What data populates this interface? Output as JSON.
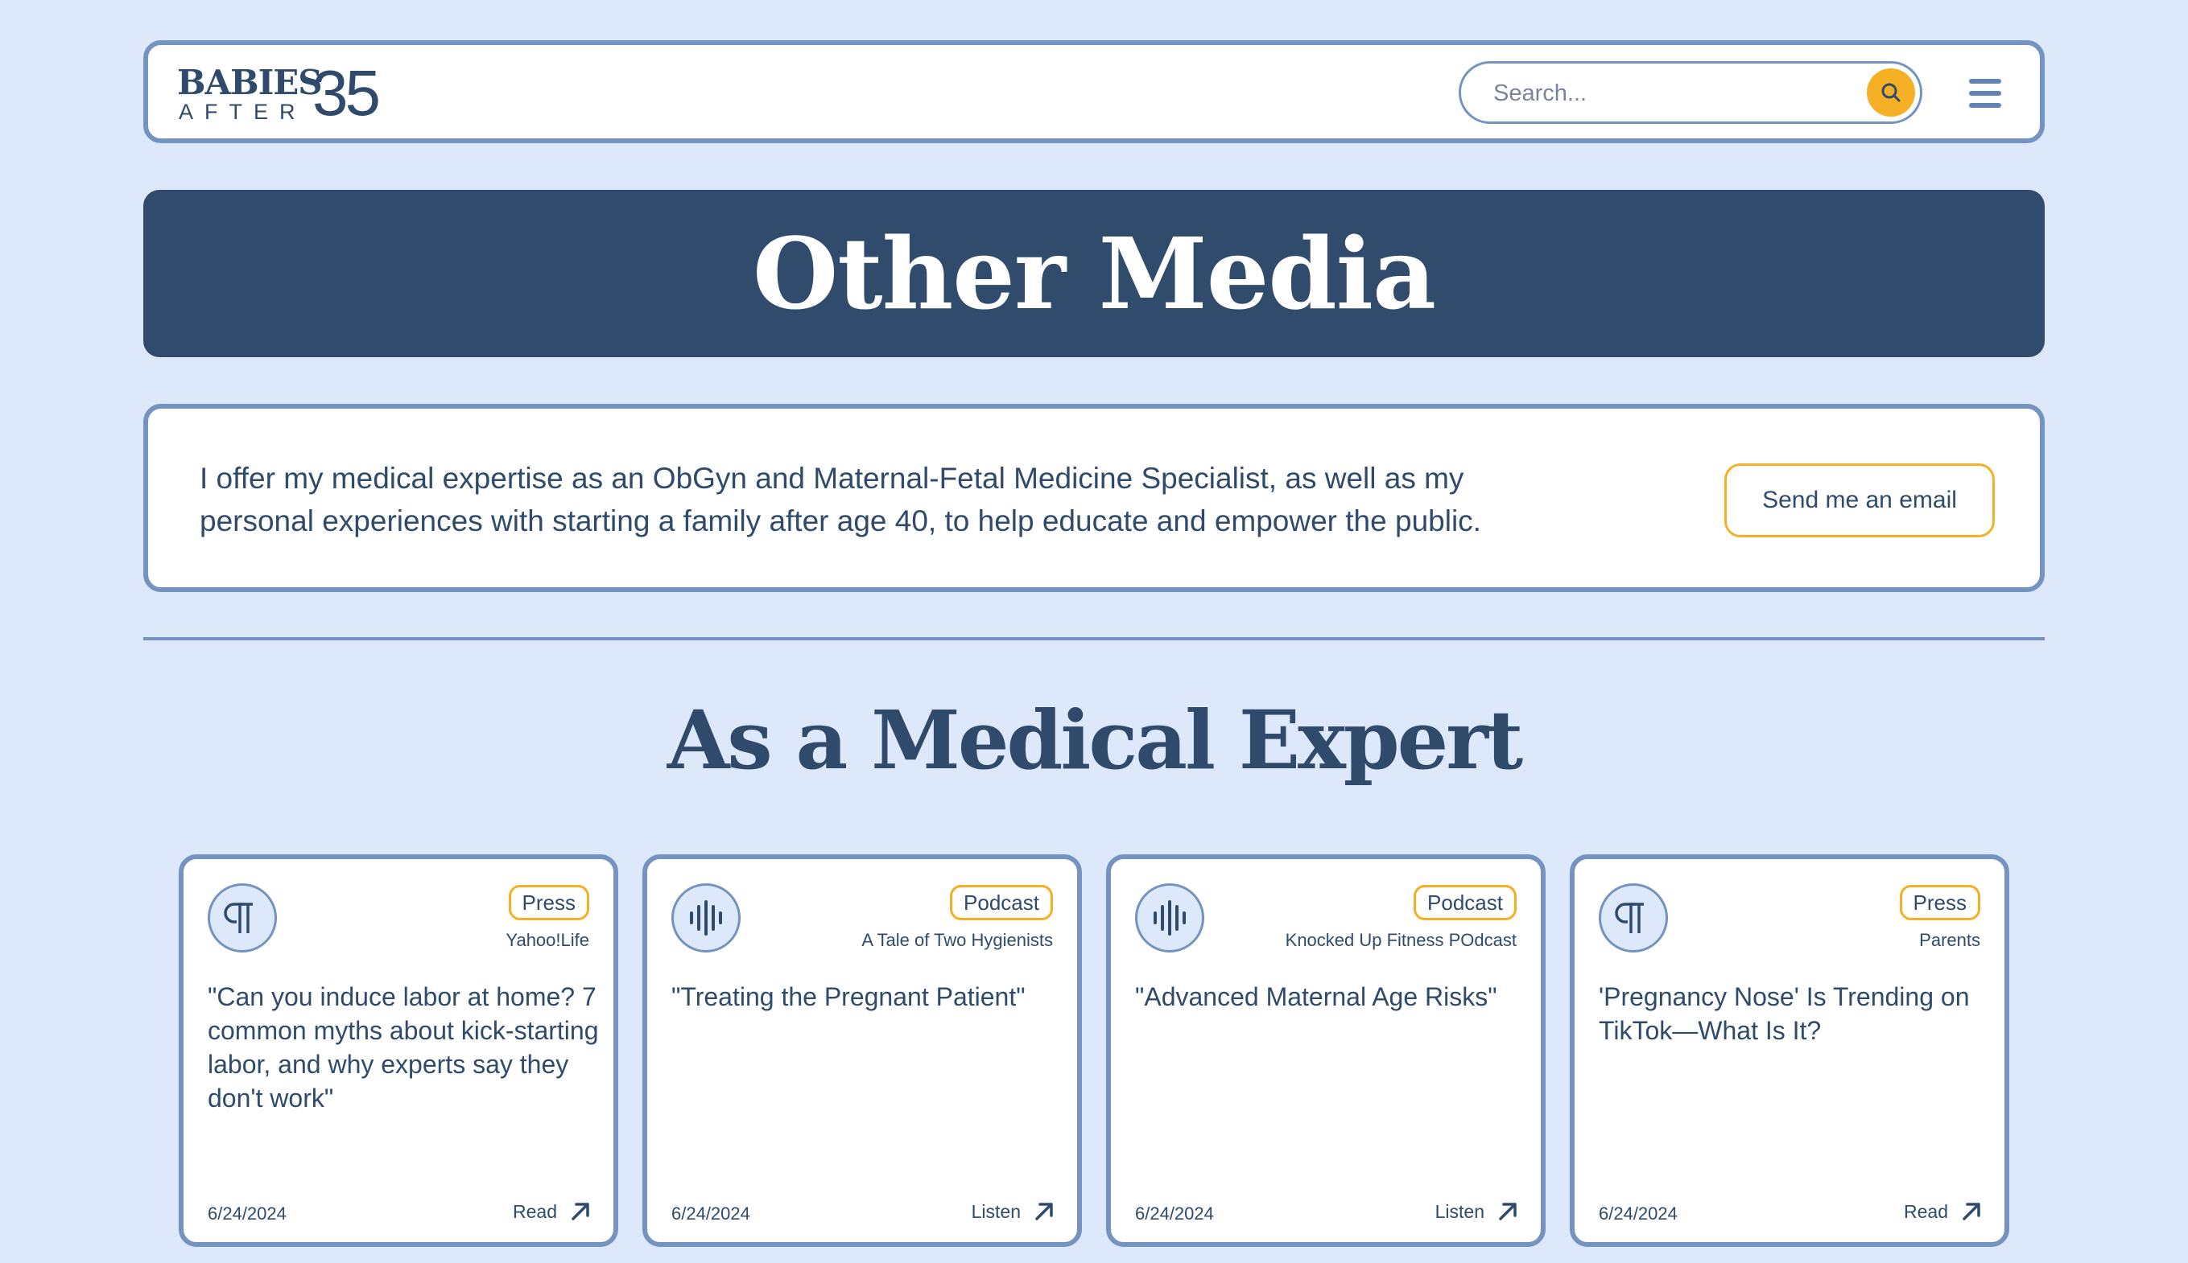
{
  "header": {
    "logo_top": "BABIES",
    "logo_bottom": "AFTER",
    "logo_number": "35",
    "search_placeholder": "Search...",
    "search_icon": "search-icon",
    "menu_icon": "hamburger-menu-icon"
  },
  "banner": {
    "title": "Other Media"
  },
  "intro": {
    "text": "I offer my medical expertise as an ObGyn and Maternal-Fetal Medicine Specialist, as well as my personal experiences with starting a family after age 40, to help educate and empower the public.",
    "button_label": "Send me an email"
  },
  "section": {
    "heading": "As a Medical Expert"
  },
  "cards": [
    {
      "icon": "paragraph-icon",
      "badge": "Press",
      "source": "Yahoo!Life",
      "title": "\"Can you induce labor at home? 7 common myths about kick-starting labor, and why experts say they don't work\"",
      "date": "6/24/2024",
      "action": "Read"
    },
    {
      "icon": "audio-waveform-icon",
      "badge": "Podcast",
      "source": "A Tale of Two Hygienists",
      "title": "\"Treating the Pregnant Patient\"",
      "date": "6/24/2024",
      "action": "Listen"
    },
    {
      "icon": "audio-waveform-icon",
      "badge": "Podcast",
      "source": "Knocked Up Fitness POdcast",
      "title": "\"Advanced Maternal Age Risks\"",
      "date": "6/24/2024",
      "action": "Listen"
    },
    {
      "icon": "paragraph-icon",
      "badge": "Press",
      "source": "Parents",
      "title": "'Pregnancy Nose' Is Trending on TikTok—What Is It?",
      "date": "6/24/2024",
      "action": "Read"
    }
  ],
  "colors": {
    "background": "#dde8fb",
    "navy": "#314b6c",
    "border_blue": "#7493c1",
    "accent_yellow": "#f5b025",
    "text": "#2f4a6b"
  }
}
